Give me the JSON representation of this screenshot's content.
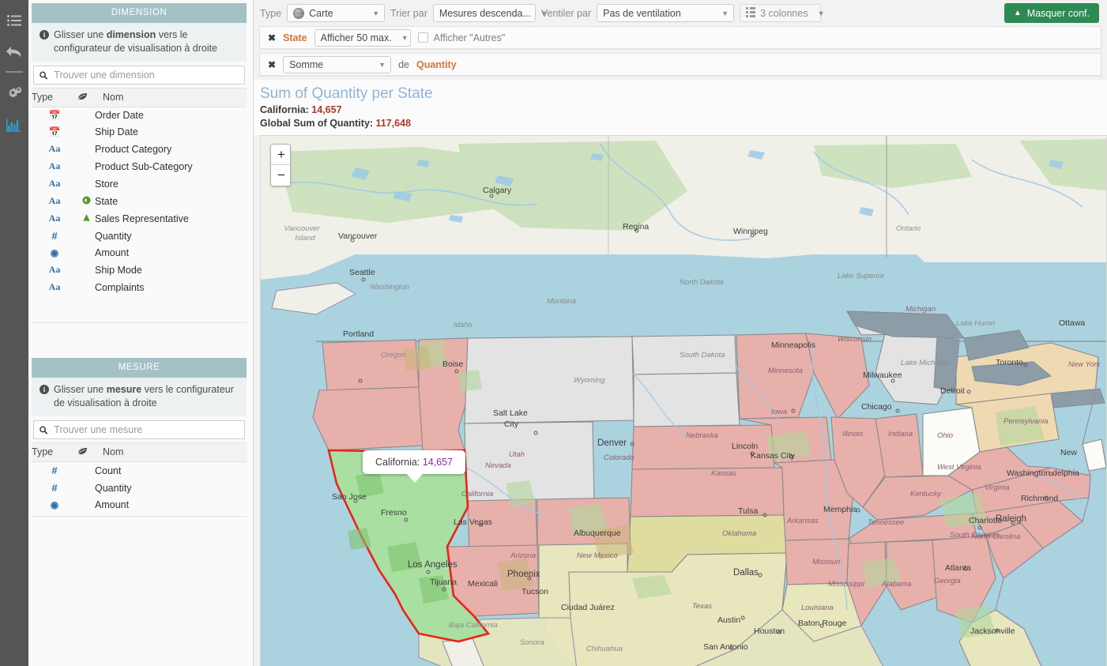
{
  "rail": {
    "items": [
      {
        "name": "list-icon",
        "label": "Liste"
      },
      {
        "name": "undo-icon",
        "label": "Annuler"
      },
      {
        "name": "settings-icon",
        "label": "Paramètres"
      },
      {
        "name": "chart-icon",
        "label": "Visualisation"
      }
    ]
  },
  "dimension_panel": {
    "header": "DIMENSION",
    "hint_before": "Glisser une ",
    "hint_bold": "dimension",
    "hint_after": " vers le configurateur de visualisation à droite",
    "search_placeholder": "Trouver une dimension",
    "search_value": "",
    "columns": {
      "type": "Type",
      "geo": "geo-leaf-icon",
      "nom": "Nom"
    },
    "rows": [
      {
        "type": "calendar",
        "geo": "",
        "name": "Order Date"
      },
      {
        "type": "Aa",
        "geo": "",
        "name": "Ship Date",
        "type_override": "calendar"
      },
      {
        "type": "Aa",
        "geo": "",
        "name": "Product Category"
      },
      {
        "type": "Aa",
        "geo": "",
        "name": "Product Sub-Category"
      },
      {
        "type": "Aa",
        "geo": "",
        "name": "Store"
      },
      {
        "type": "Aa",
        "geo": "globe",
        "name": "State"
      },
      {
        "type": "Aa",
        "geo": "cone",
        "name": "Sales Representative"
      },
      {
        "type": "#",
        "geo": "",
        "name": "Quantity"
      },
      {
        "type": "amount",
        "geo": "",
        "name": "Amount"
      },
      {
        "type": "Aa",
        "geo": "",
        "name": "Ship Mode"
      },
      {
        "type": "Aa",
        "geo": "",
        "name": "Complaints"
      }
    ]
  },
  "mesure_panel": {
    "header": "MESURE",
    "hint_before": "Glisser une ",
    "hint_bold": "mesure",
    "hint_after": " vers le configurateur de visualisation à droite",
    "search_placeholder": "Trouver une mesure",
    "search_value": "",
    "columns": {
      "type": "Type",
      "geo": "geo-leaf-icon",
      "nom": "Nom"
    },
    "rows": [
      {
        "type": "#",
        "geo": "",
        "name": "Count"
      },
      {
        "type": "#",
        "geo": "",
        "name": "Quantity"
      },
      {
        "type": "amount",
        "geo": "",
        "name": "Amount"
      }
    ]
  },
  "toolbar": {
    "type_label": "Type",
    "type_value": "Carte",
    "sort_label": "Trier par",
    "sort_value": "Mesures descenda...",
    "split_label": "Ventiler par",
    "split_value": "Pas de ventilation",
    "columns_value": "3 colonnes",
    "hide_config_label": "Masquer conf."
  },
  "config_rows": {
    "dimension_row": {
      "remove": "✖",
      "field": "State",
      "display_limit": "Afficher 50 max.",
      "checkbox_label": "Afficher \"Autres\"",
      "checkbox_checked": false
    },
    "measure_row": {
      "remove": "✖",
      "aggregation": "Somme",
      "of_label": "de",
      "field": "Quantity"
    }
  },
  "visualization": {
    "title": "Sum of Quantity per State",
    "selected_label": "California:",
    "selected_value": "14,657",
    "global_label": "Global Sum of Quantity:",
    "global_value": "117,648",
    "zoom_in": "+",
    "zoom_out": "−",
    "tooltip_label": "California:",
    "tooltip_value": "14,657"
  },
  "map": {
    "highlight_state": "California",
    "highlight_fill": "#a9dfa0",
    "highlight_stroke": "#e8231c",
    "water_color": "#aad3df",
    "land_color": "#f0efe8",
    "state_colors": {
      "high": "#e8b0ab",
      "medium": "#efd9b2",
      "low": "#e3e3e3",
      "pale_yellow": "#e7e6bd"
    },
    "cities": [
      "Calgary",
      "Regina",
      "Winnipeg",
      "Vancouver",
      "Vancouver Island",
      "Seattle",
      "Portland",
      "Boise",
      "Salt Lake City",
      "Denver",
      "San Jose",
      "Fresno",
      "Los Angeles",
      "Las Vegas",
      "Tijuana",
      "Mexicali",
      "Phoenix",
      "Tucson",
      "Albuquerque",
      "Ciudad Juárez",
      "Dallas",
      "Austin",
      "San Antonio",
      "Houston",
      "Baton Rouge",
      "Lincoln",
      "Kansas City",
      "Tulsa",
      "Minneapolis",
      "Milwaukee",
      "Chicago",
      "Detroit",
      "Toronto",
      "Ottawa",
      "Memphis",
      "Atlanta",
      "Charlotte",
      "Raleigh",
      "Richmond",
      "Washington",
      "Philadelphia",
      "New York",
      "Jacksonville"
    ],
    "regions": [
      "Ontario",
      "Washington",
      "Oregon",
      "Idaho",
      "Montana",
      "Wyoming",
      "North Dakota",
      "South Dakota",
      "Nebraska",
      "Kansas",
      "Minnesota",
      "Wisconsin",
      "Iowa",
      "Missouri",
      "Illinois",
      "Indiana",
      "Michigan",
      "Ohio",
      "Kentucky",
      "Tennessee",
      "Arkansas",
      "Mississippi",
      "Alabama",
      "Georgia",
      "South Carolina",
      "North Carolina",
      "Virginia",
      "West Virginia",
      "Pennsylvania",
      "New York",
      "Utah",
      "Colorado",
      "Arizona",
      "New Mexico",
      "Texas",
      "Oklahoma",
      "Louisiana",
      "California",
      "Nevada",
      "Lake Superior",
      "Lake Michigan",
      "Lake Huron",
      "Baja California",
      "Sonora",
      "Chihuahua"
    ]
  }
}
